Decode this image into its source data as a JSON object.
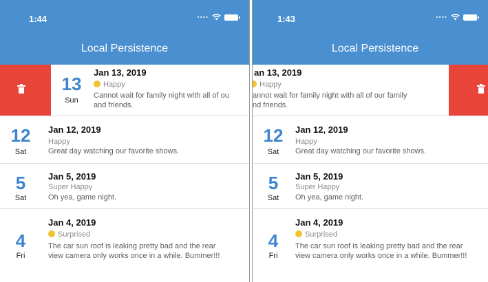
{
  "left": {
    "time": "1:44",
    "title": "Local Persistence",
    "swiped": {
      "daynum": "13",
      "dayname": "Sun",
      "date": "Jan 13, 2019",
      "mood": "Happy",
      "note_line1": "Cannot wait for family night with all of ou",
      "note_line2": "and friends."
    }
  },
  "right": {
    "time": "1:43",
    "title": "Local Persistence",
    "swiped": {
      "date": "an 13, 2019",
      "mood": "Happy",
      "note_line1": "annot wait for family night with all of our family",
      "note_line2": "nd friends."
    }
  },
  "entries": [
    {
      "daynum": "12",
      "dayname": "Sat",
      "date": "Jan 12, 2019",
      "mood": "Happy",
      "note": "Great day watching our favorite shows."
    },
    {
      "daynum": "5",
      "dayname": "Sat",
      "date": "Jan 5, 2019",
      "mood": "Super Happy",
      "note": "Oh yea, game night."
    },
    {
      "daynum": "4",
      "dayname": "Fri",
      "date": "Jan 4, 2019",
      "mood": "Surprised",
      "note": "The car sun roof is leaking pretty bad and the rear view camera only works once in a while. Bummer!!!"
    }
  ],
  "icons": {
    "wifi": "wifi-icon",
    "battery": "battery-icon",
    "trash": "trash-icon",
    "mood": "emoji-icon"
  },
  "colors": {
    "app_bar": "#4a8fcf",
    "accent": "#3d86cf",
    "delete": "#e9443a"
  }
}
